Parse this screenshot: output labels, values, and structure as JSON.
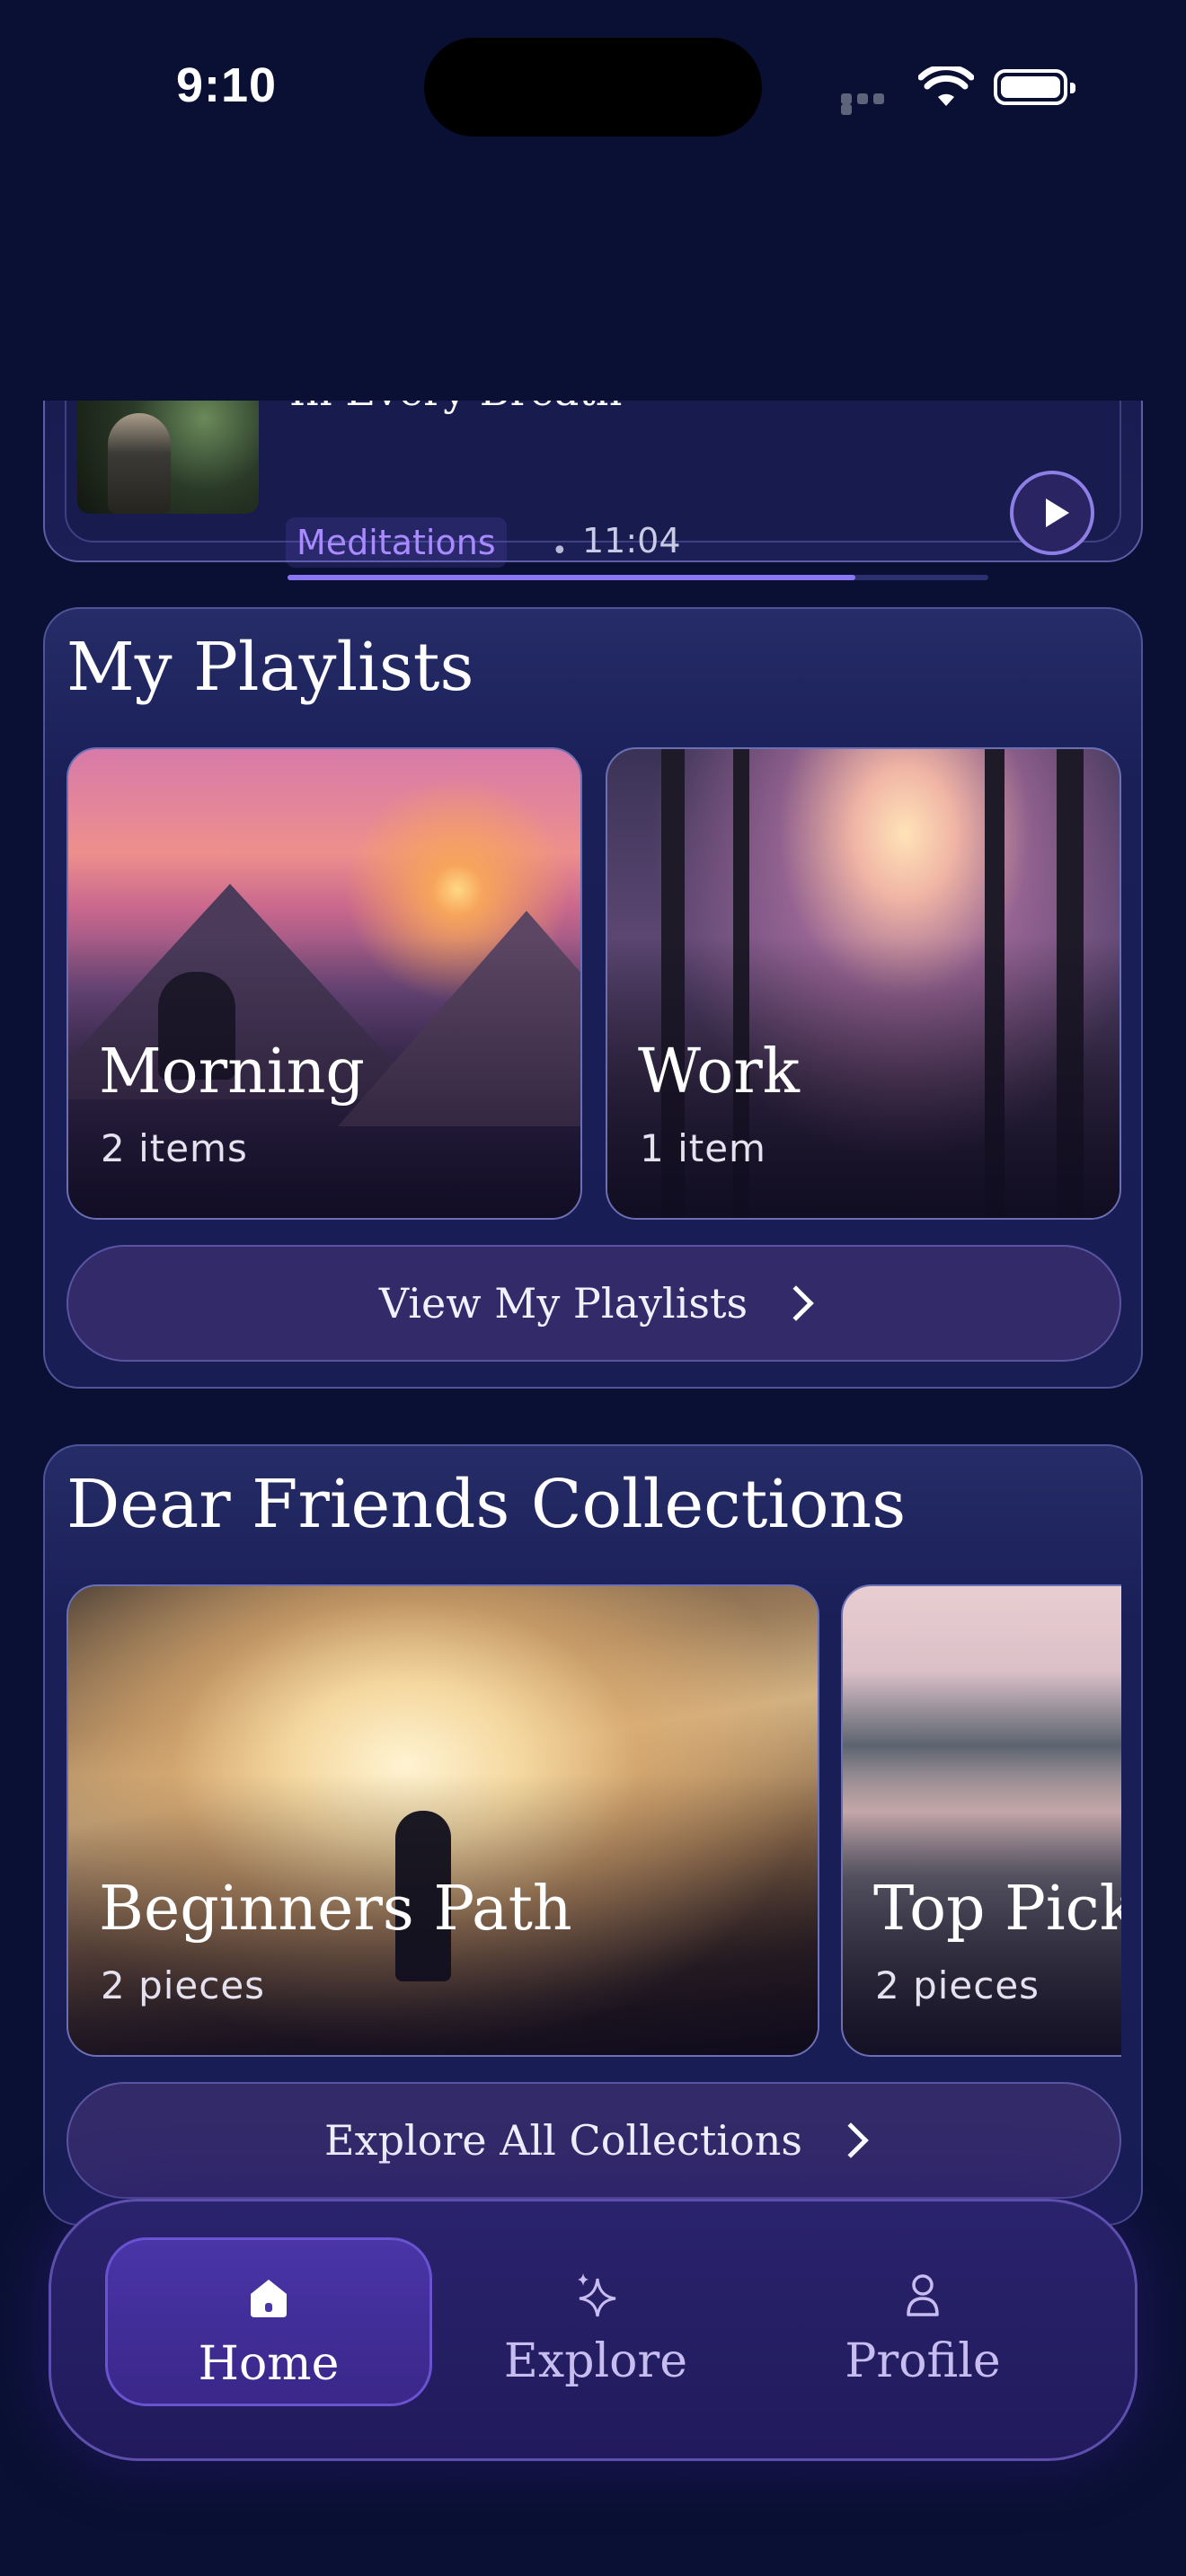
{
  "status_bar": {
    "time": "9:10"
  },
  "now_playing": {
    "title": "In Every Breath",
    "category": "Meditations",
    "separator": "•",
    "duration": "11:04",
    "progress": 0.81
  },
  "my_playlists": {
    "title": "My Playlists",
    "items": [
      {
        "name": "Morning",
        "count": "2 items"
      },
      {
        "name": "Work",
        "count": "1 item"
      }
    ],
    "button_label": "View My Playlists"
  },
  "collections": {
    "title": "Dear Friends Collections",
    "items": [
      {
        "name": "Beginners Path",
        "count": "2 pieces"
      },
      {
        "name": "Top Picks",
        "count": "2 pieces"
      }
    ],
    "button_label": "Explore All Collections"
  },
  "tab_bar": {
    "tabs": [
      {
        "label": "Home",
        "icon": "home-icon",
        "active": true
      },
      {
        "label": "Explore",
        "icon": "sparkles-icon",
        "active": false
      },
      {
        "label": "Profile",
        "icon": "person-icon",
        "active": false
      }
    ]
  },
  "colors": {
    "background": "#0a1033",
    "accent": "#8b77f5",
    "tab_active": "#4a35a8"
  }
}
